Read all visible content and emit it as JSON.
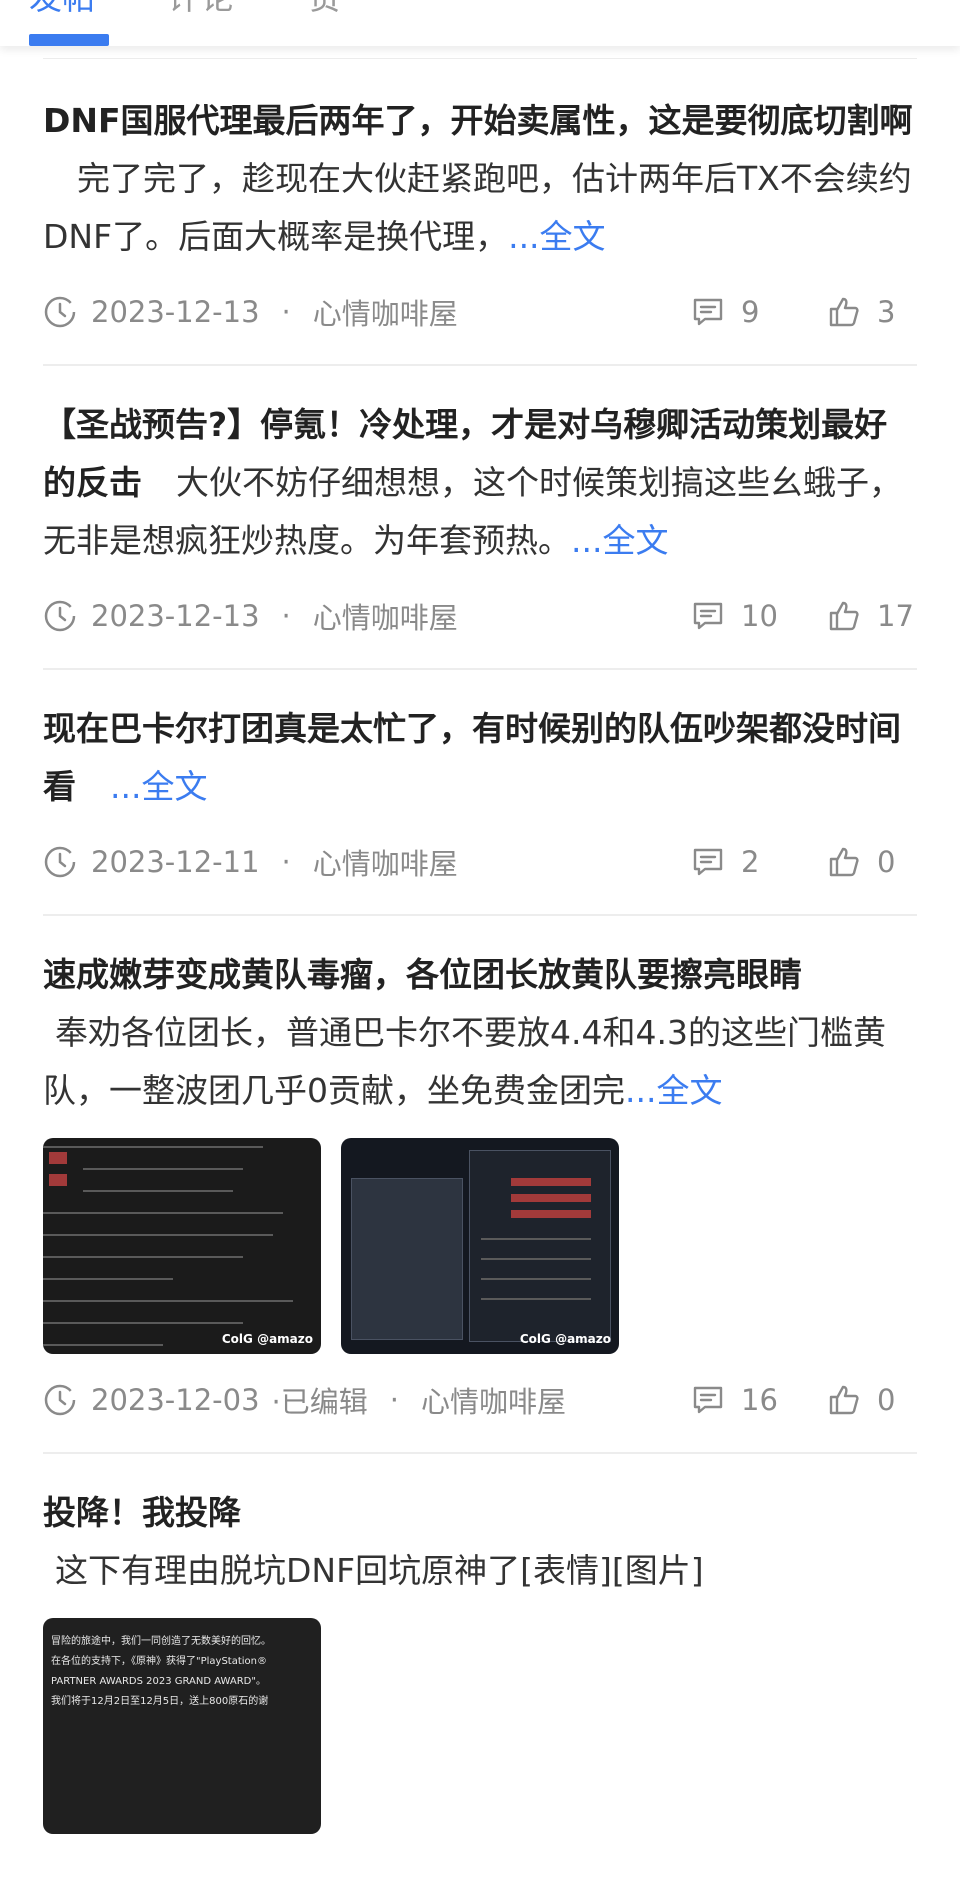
{
  "tabs": [
    {
      "label": "发帖",
      "active": true
    },
    {
      "label": "评论",
      "active": false
    },
    {
      "label": "赞",
      "active": false
    }
  ],
  "colors": {
    "accent": "#3b7cf0",
    "meta_text": "#8a8a8a",
    "divider": "#ededed"
  },
  "more_label": "...全文",
  "posts": [
    {
      "title": "DNF国服代理最后两年了，开始卖属性，这是要彻底切割啊",
      "excerpt": "完了完了，趁现在大伙赶紧跑吧，估计两年后TX不会续约DNF了。后面大概率是换代理，",
      "date": "2023-12-13",
      "author": "心情咖啡屋",
      "comments": "9",
      "likes": "3"
    },
    {
      "title": "【圣战预告?】停氪！冷处理，才是对乌穆卿活动策划最好的反击",
      "excerpt": "大伙不妨仔细想想，这个时候策划搞这些幺蛾子，无非是想疯狂炒热度。为年套预热。",
      "date": "2023-12-13",
      "author": "心情咖啡屋",
      "comments": "10",
      "likes": "17"
    },
    {
      "title": "现在巴卡尔打团真是太忙了，有时候别的队伍吵架都没时间看",
      "excerpt": "",
      "date": "2023-12-11",
      "author": "心情咖啡屋",
      "comments": "2",
      "likes": "0"
    },
    {
      "title": "速成嫩芽变成黄队毒瘤，各位团长放黄队要擦亮眼睛",
      "excerpt": "奉劝各位团长，普通巴卡尔不要放4.4和4.3的这些门槛黄队，一整波团几乎0贡献，坐免费金团完",
      "date": "2023-12-03",
      "edited": "·已编辑",
      "author": "心情咖啡屋",
      "comments": "16",
      "likes": "0"
    },
    {
      "title": "投降！我投降",
      "excerpt": "这下有理由脱坑DNF回坑原神了[表情][图片]"
    }
  ],
  "thumbs": [
    {
      "name": "chat-screenshot-thumbnail",
      "watermark": "ColG @amazo"
    },
    {
      "name": "game-window-screenshot-thumbnail",
      "watermark": "ColG @amazo"
    }
  ],
  "thumb5": {
    "lines": [
      "冒险的旅途中，我们一同创造了无数美好的回忆。",
      "在各位的支持下，《原神》获得了\"PlayStation®",
      "PARTNER AWARDS 2023 GRAND AWARD\"。",
      "我们将于12月2日至12月5日，送上800原石的谢"
    ]
  },
  "icons": {
    "clock": "clock-icon",
    "comment": "comment-icon",
    "like": "thumbs-up-icon"
  }
}
